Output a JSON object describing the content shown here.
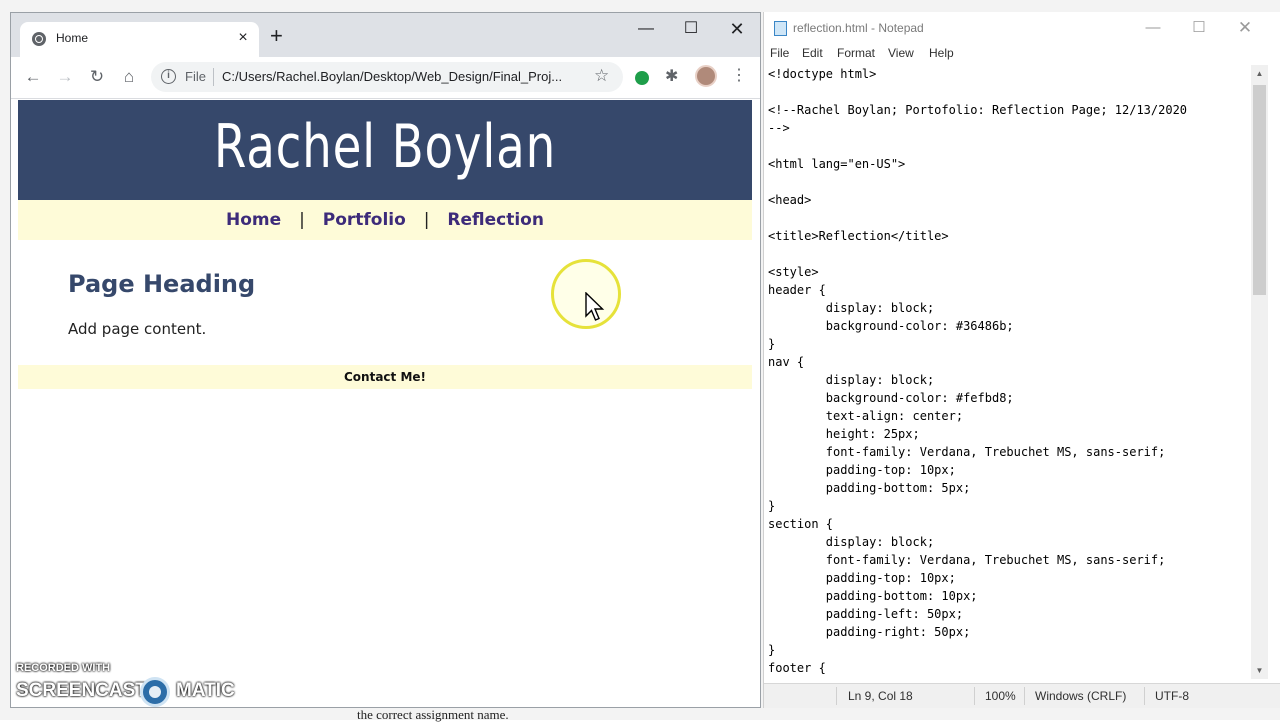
{
  "background": {
    "doc_text": "the correct assignment name."
  },
  "browser": {
    "tab_title": "Home",
    "tab_close": "×",
    "new_tab": "+",
    "window_controls": {
      "minimize": "—",
      "maximize": "☐",
      "close": "✕"
    },
    "nav": {
      "back": "←",
      "forward": "→",
      "reload": "↻",
      "home": "⌂"
    },
    "address_info": "i",
    "address_scheme_label": "File",
    "url": "C:/Users/Rachel.Boylan/Desktop/Web_Design/Final_Proj...",
    "star": "☆",
    "puzzle": "✱",
    "menu": "⋮"
  },
  "website": {
    "header_title": "Rachel Boylan",
    "nav_links": [
      "Home",
      "Portfolio",
      "Reflection"
    ],
    "nav_separator": "|",
    "page_heading": "Page Heading",
    "page_content": "Add page content.",
    "footer_text": "Contact Me!",
    "colors": {
      "header_bg": "#36486b",
      "nav_bg": "#fefbd8"
    }
  },
  "watermark": {
    "recorded_with": "RECORDED WITH",
    "brand_left": "SCREENCAST",
    "brand_right": "MATIC"
  },
  "notepad": {
    "title": "reflection.html - Notepad",
    "window_controls": {
      "minimize": "—",
      "maximize": "☐",
      "close": "✕"
    },
    "menu": [
      "File",
      "Edit",
      "Format",
      "View",
      "Help"
    ],
    "code_lines": [
      "<!doctype html>",
      "",
      "<!--Rachel Boylan; Portofolio: Reflection Page; 12/13/2020",
      "-->",
      "",
      "<html lang=\"en-US\">",
      "",
      "<head>",
      "",
      "<title>Reflection</title>",
      "",
      "<style>",
      "header {",
      "        display: block;",
      "        background-color: #36486b;",
      "}",
      "nav {",
      "        display: block;",
      "        background-color: #fefbd8;",
      "        text-align: center;",
      "        height: 25px;",
      "        font-family: Verdana, Trebuchet MS, sans-serif;",
      "        padding-top: 10px;",
      "        padding-bottom: 5px;",
      "}",
      "section {",
      "        display: block;",
      "        font-family: Verdana, Trebuchet MS, sans-serif;",
      "        padding-top: 10px;",
      "        padding-bottom: 10px;",
      "        padding-left: 50px;",
      "        padding-right: 50px;",
      "}",
      "footer {"
    ],
    "status": {
      "position": "Ln 9, Col 18",
      "zoom": "100%",
      "line_endings": "Windows (CRLF)",
      "encoding": "UTF-8"
    }
  }
}
